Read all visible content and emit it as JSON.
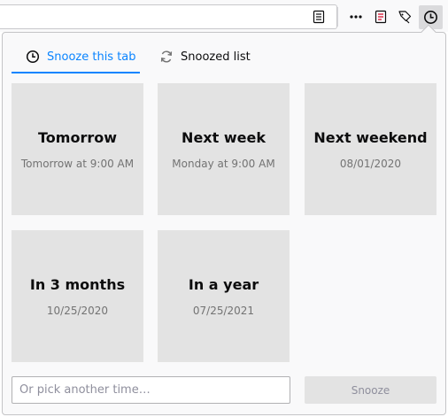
{
  "tabs": [
    {
      "label": "Snooze this tab",
      "icon": "clock-icon",
      "active": true
    },
    {
      "label": "Snoozed list",
      "icon": "sync-icon",
      "active": false
    }
  ],
  "options": [
    {
      "title": "Tomorrow",
      "subtitle": "Tomorrow at 9:00 AM"
    },
    {
      "title": "Next week",
      "subtitle": "Monday at 9:00 AM"
    },
    {
      "title": "Next weekend",
      "subtitle": "08/01/2020"
    },
    {
      "title": "In 3 months",
      "subtitle": "10/25/2020"
    },
    {
      "title": "In a year",
      "subtitle": "07/25/2021"
    }
  ],
  "custom_time": {
    "placeholder": "Or pick another time…",
    "value": ""
  },
  "snooze_button": {
    "label": "Snooze",
    "enabled": false
  },
  "colors": {
    "accent": "#0a84ff",
    "tile_background": "#e3e3e3",
    "panel_background": "#f9f9fa"
  }
}
